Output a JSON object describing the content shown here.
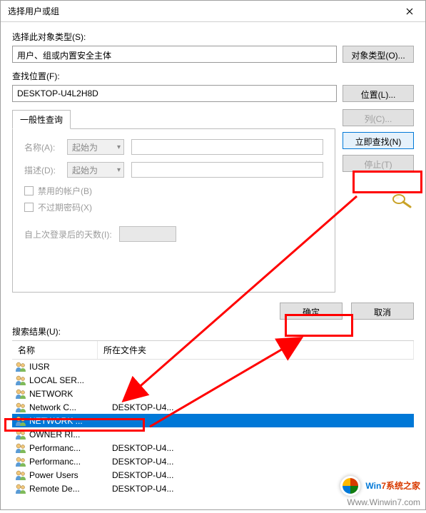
{
  "titlebar": {
    "title": "选择用户或组"
  },
  "labels": {
    "object_type": "选择此对象类型(S):",
    "object_type_btn": "对象类型(O)...",
    "location": "查找位置(F):",
    "location_btn": "位置(L)...",
    "tab": "一般性查询",
    "name": "名称(A):",
    "desc": "描述(D):",
    "starts_with": "起始为",
    "chk_disabled": "禁用的帐户(B)",
    "chk_noexpire": "不过期密码(X)",
    "days_since_logon": "自上次登录后的天数(I):",
    "columns_btn": "列(C)...",
    "find_now_btn": "立即查找(N)",
    "stop_btn": "停止(T)",
    "ok_btn": "确定",
    "cancel_btn": "取消",
    "results": "搜索结果(U):",
    "col_name": "名称",
    "col_folder": "所在文件夹"
  },
  "values": {
    "object_type": "用户、组或内置安全主体",
    "location": "DESKTOP-U4L2H8D"
  },
  "results_list": [
    {
      "name": "IUSR",
      "folder": "",
      "selected": false
    },
    {
      "name": "LOCAL SER...",
      "folder": "",
      "selected": false
    },
    {
      "name": "NETWORK",
      "folder": "",
      "selected": false
    },
    {
      "name": "Network C...",
      "folder": "DESKTOP-U4...",
      "selected": false
    },
    {
      "name": "NETWORK ...",
      "folder": "",
      "selected": true
    },
    {
      "name": "OWNER RI...",
      "folder": "",
      "selected": false
    },
    {
      "name": "Performanc...",
      "folder": "DESKTOP-U4...",
      "selected": false
    },
    {
      "name": "Performanc...",
      "folder": "DESKTOP-U4...",
      "selected": false
    },
    {
      "name": "Power Users",
      "folder": "DESKTOP-U4...",
      "selected": false
    },
    {
      "name": "Remote De...",
      "folder": "DESKTOP-U4...",
      "selected": false
    }
  ],
  "watermark": {
    "brand_left": "Win",
    "brand_right": "7系统之家",
    "url": "Www.Winwin7.com"
  }
}
